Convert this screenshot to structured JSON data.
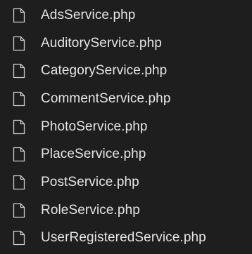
{
  "explorer": {
    "files": [
      {
        "name": "AdsService.php",
        "icon": "file-icon"
      },
      {
        "name": "AuditoryService.php",
        "icon": "file-icon"
      },
      {
        "name": "CategoryService.php",
        "icon": "file-icon"
      },
      {
        "name": "CommentService.php",
        "icon": "file-icon"
      },
      {
        "name": "PhotoService.php",
        "icon": "file-icon"
      },
      {
        "name": "PlaceService.php",
        "icon": "file-icon"
      },
      {
        "name": "PostService.php",
        "icon": "file-icon"
      },
      {
        "name": "RoleService.php",
        "icon": "file-icon"
      },
      {
        "name": "UserRegisteredService.php",
        "icon": "file-icon"
      }
    ]
  },
  "colors": {
    "background": "#1e1e1e",
    "text": "#e6e6e6",
    "icon_stroke": "#cfcfcf"
  }
}
